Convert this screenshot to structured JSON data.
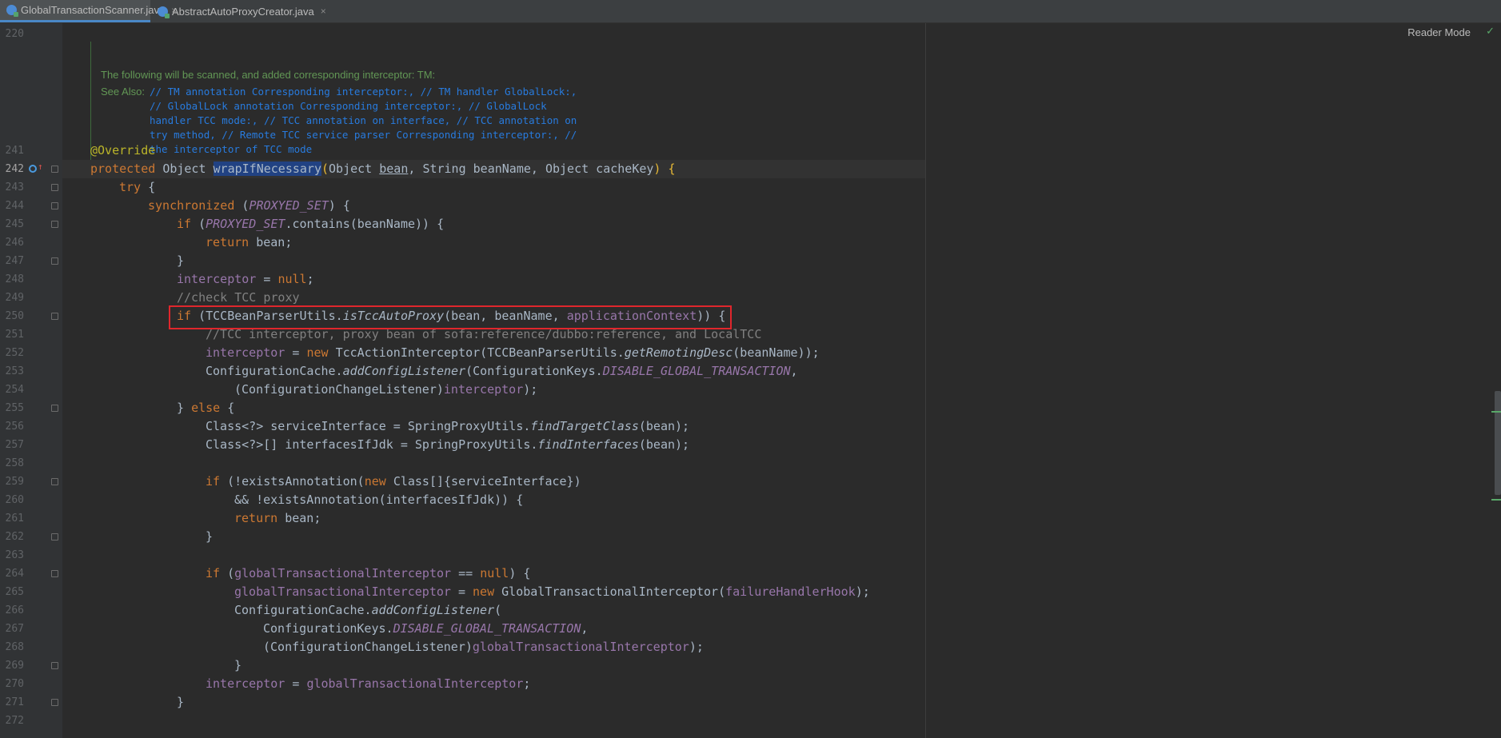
{
  "tabs": [
    {
      "label": "GlobalTransactionScanner.java",
      "close": "×"
    },
    {
      "label": "AbstractAutoProxyCreator.java",
      "close": "×"
    }
  ],
  "reader_mode": "Reader Mode",
  "javadoc": {
    "line_number": "220",
    "title": "The following will be scanned, and added corresponding interceptor: TM:",
    "see_also_label": "See Also:",
    "see_also_lines": [
      "// TM annotation Corresponding interceptor:, // TM handler GlobalLock:,",
      "// GlobalLock annotation Corresponding interceptor:, // GlobalLock",
      "handler TCC mode:, // TCC annotation on interface, // TCC annotation on",
      "try method, // Remote TCC service parser Corresponding interceptor:, //",
      "the interceptor of TCC mode"
    ]
  },
  "line_numbers": [
    "241",
    "242",
    "243",
    "244",
    "245",
    "246",
    "247",
    "248",
    "249",
    "250",
    "251",
    "252",
    "253",
    "254",
    "255",
    "256",
    "257",
    "258",
    "259",
    "260",
    "261",
    "262",
    "263",
    "264",
    "265",
    "266",
    "267",
    "268",
    "269",
    "270",
    "271",
    "272"
  ],
  "code": {
    "l241": "@Override",
    "l242": {
      "kw": "protected ",
      "t1": "Object ",
      "m": "wrapIfNecessary",
      "p1": "(",
      "t2": "Object ",
      "v1": "bean",
      ", ": ", ",
      "t3": "String beanName, Object cacheKey",
      "p2": ") {"
    },
    "l243": {
      "kw": "try ",
      "b": "{"
    },
    "l244": {
      "kw": "synchronized ",
      "p1": "(",
      "f": "PROXYED_SET",
      "p2": ") {"
    },
    "l245": {
      "kw": "if ",
      "p1": "(",
      "f": "PROXYED_SET",
      ".": ".contains(beanName)) {"
    },
    "l246": {
      "kw": "return ",
      "t": "bean;"
    },
    "l247": "}",
    "l248": {
      "f": "interceptor",
      " = ": " = ",
      "kw": "null",
      ";": ";"
    },
    "l249": "//check TCC proxy",
    "l250": {
      "kw": "if ",
      "p1": "(",
      "c": "TCCBeanParserUtils.",
      "m": "isTccAutoProxy",
      "a": "(bean, beanName, ",
      "f": "applicationContext",
      "e": ")) {"
    },
    "l251": "//TCC interceptor, proxy bean of sofa:reference/dubbo:reference, and LocalTCC",
    "l252": {
      "f": "interceptor",
      " = ": " = ",
      "kw": "new ",
      "c": "TccActionInterceptor(TCCBeanParserUtils.",
      "m": "getRemotingDesc",
      "e": "(beanName));"
    },
    "l253": {
      "c": "ConfigurationCache.",
      "m": "addConfigListener",
      "p": "(ConfigurationKeys.",
      "f": "DISABLE_GLOBAL_TRANSACTION",
      "e": ","
    },
    "l254": {
      "p": "(ConfigurationChangeListener)",
      "f": "interceptor",
      "e": ");"
    },
    "l255": {
      "b": "} ",
      "kw": "else ",
      "e": "{"
    },
    "l256": {
      "c": "Class<?> serviceInterface = SpringProxyUtils.",
      "m": "findTargetClass",
      "e": "(bean);"
    },
    "l257": {
      "c": "Class<?>[] interfacesIfJdk = SpringProxyUtils.",
      "m": "findInterfaces",
      "e": "(bean);"
    },
    "l258": "",
    "l259": {
      "kw": "if ",
      "p": "(!existsAnnotation(",
      "kw2": "new ",
      "e": "Class[]{serviceInterface})"
    },
    "l260": "&& !existsAnnotation(interfacesIfJdk)) {",
    "l261": {
      "kw": "return ",
      "t": "bean;"
    },
    "l262": "}",
    "l263": "",
    "l264": {
      "kw": "if ",
      "p": "(",
      "f": "globalTransactionalInterceptor",
      " == ": " == ",
      "kw2": "null",
      "e": ") {"
    },
    "l265": {
      "f": "globalTransactionalInterceptor",
      " = ": " = ",
      "kw": "new ",
      "c": "GlobalTransactionalInterceptor(",
      "f2": "failureHandlerHook",
      "e": ");"
    },
    "l266": {
      "c": "ConfigurationCache.",
      "m": "addConfigListener",
      "e": "("
    },
    "l267": {
      "c": "ConfigurationKeys.",
      "f": "DISABLE_GLOBAL_TRANSACTION",
      "e": ","
    },
    "l268": {
      "p": "(ConfigurationChangeListener)",
      "f": "globalTransactionalInterceptor",
      "e": ");"
    },
    "l269": "}",
    "l270": {
      "f": "interceptor",
      " = ": " = ",
      "f2": "globalTransactionalInterceptor",
      "e": ";"
    },
    "l271": "}",
    "l272": ""
  },
  "colors": {
    "keyword": "#cc7832",
    "field": "#9876aa",
    "comment": "#808080",
    "annotation": "#bbb529",
    "highlight_box": "#e0262c",
    "doc_text": "#629755",
    "doc_link": "#287bde"
  },
  "icons": [
    "class-file-icon",
    "override-marker-icon",
    "fold-icon",
    "checkmark-icon"
  ]
}
